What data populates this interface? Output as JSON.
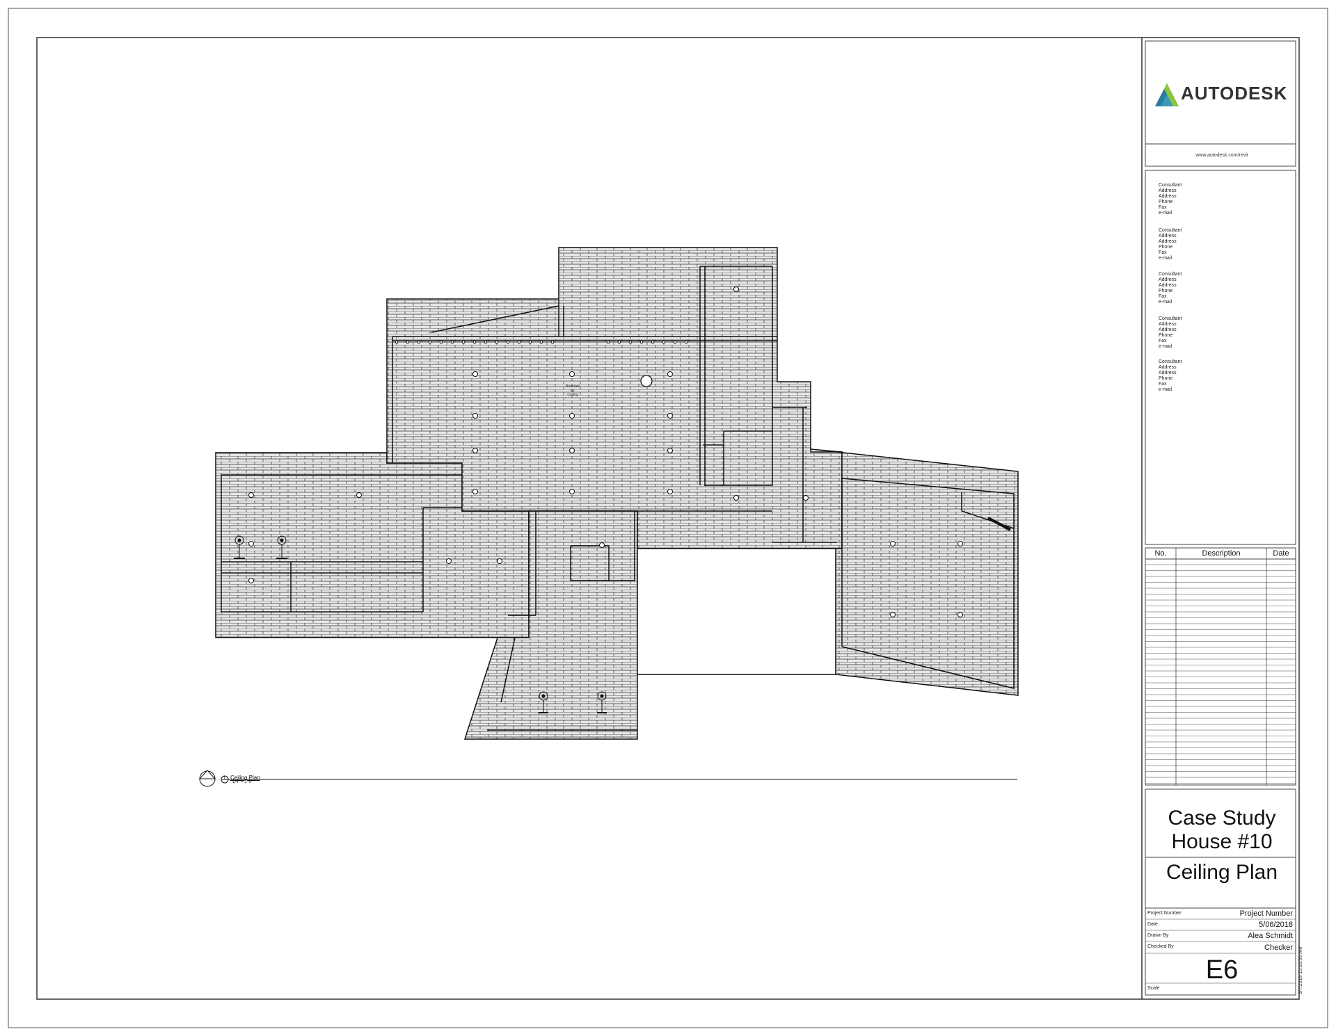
{
  "logo": {
    "name": "AUTODESK",
    "url": "www.autodesk.com/revit"
  },
  "consultants": [
    {
      "lines": [
        "Consultant",
        "Address",
        "Address",
        "Phone",
        "Fax",
        "e-mail"
      ]
    },
    {
      "lines": [
        "Consultant",
        "Address",
        "Address",
        "Phone",
        "Fax",
        "e-mail"
      ]
    },
    {
      "lines": [
        "Consultant",
        "Address",
        "Address",
        "Phone",
        "Fax",
        "e-mail"
      ]
    },
    {
      "lines": [
        "Consultant",
        "Address",
        "Address",
        "Phone",
        "Fax",
        "e-mail"
      ]
    },
    {
      "lines": [
        "Consultant",
        "Address",
        "Address",
        "Phone",
        "Fax",
        "e-mail"
      ]
    }
  ],
  "revisions": {
    "headers": {
      "no": "No.",
      "description": "Description",
      "date": "Date"
    }
  },
  "project": {
    "name_line1": "Case Study",
    "name_line2": "House #10",
    "sheet_name": "Ceiling Plan",
    "fields": [
      {
        "label": "Project Number",
        "value": "Project Number"
      },
      {
        "label": "Date",
        "value": "5/06/2018"
      },
      {
        "label": "Drawn By",
        "value": "Alea Schmidt"
      },
      {
        "label": "Checked By",
        "value": "Checker"
      }
    ],
    "sheet_number": "E6",
    "scale_label": "Scale"
  },
  "view": {
    "number": "1",
    "title": "Ceiling Plan",
    "scale": "1/4\" = 1'-0\""
  },
  "plot_stamp": "5/7/2018 10:32:00 AM",
  "ceiling_note": {
    "line1": "Bounded",
    "line2": "by",
    "line3": "Ceiling"
  }
}
